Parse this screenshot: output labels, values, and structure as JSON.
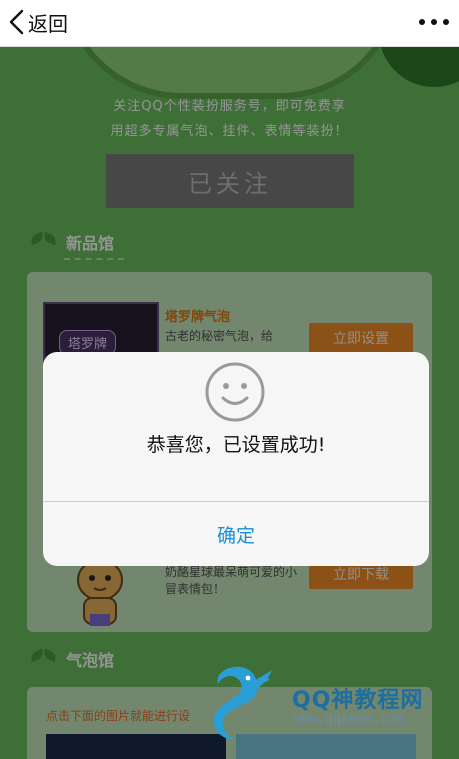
{
  "navbar": {
    "back_label": "返回"
  },
  "page": {
    "promo_line1": "关注QQ个性装扮服务号，即可免费享",
    "promo_line2": "用超多专属气泡、挂件、表情等装扮！",
    "follow_label": "已关注",
    "sections": [
      {
        "title": "新品馆"
      },
      {
        "title": "气泡馆"
      }
    ],
    "new_items": [
      {
        "thumb_label": "塔罗牌",
        "title": "塔罗牌气泡",
        "desc": "古老的秘密气泡，给",
        "button": "立即设置"
      },
      {
        "desc": "奶酪星球最呆萌可爱的小冒表情包！",
        "button": "立即下载"
      }
    ],
    "bubble_hint": "点击下面的图片就能进行设"
  },
  "dialog": {
    "message": "恭喜您，已设置成功!",
    "confirm": "确定"
  },
  "watermark": {
    "title": "QQ神教程网",
    "url": "www.qqshen.com"
  },
  "colors": {
    "background_green": "#6cc05f",
    "link_blue": "#1a8fd6",
    "button_orange": "#f28c28"
  }
}
